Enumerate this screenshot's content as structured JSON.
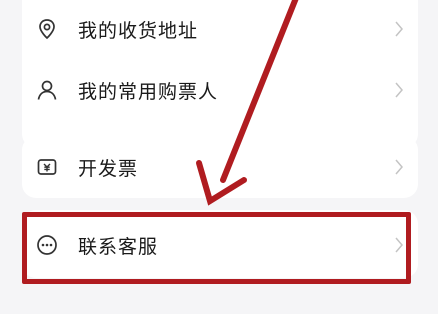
{
  "menu": {
    "items": [
      {
        "label": "我的收货地址",
        "icon": "location-pin-icon"
      },
      {
        "label": "我的常用购票人",
        "icon": "person-icon"
      },
      {
        "label": "开发票",
        "icon": "invoice-icon"
      },
      {
        "label": "联系客服",
        "icon": "chat-bubble-icon"
      }
    ]
  },
  "annotation": {
    "color": "#b01c20",
    "target": "联系客服"
  }
}
